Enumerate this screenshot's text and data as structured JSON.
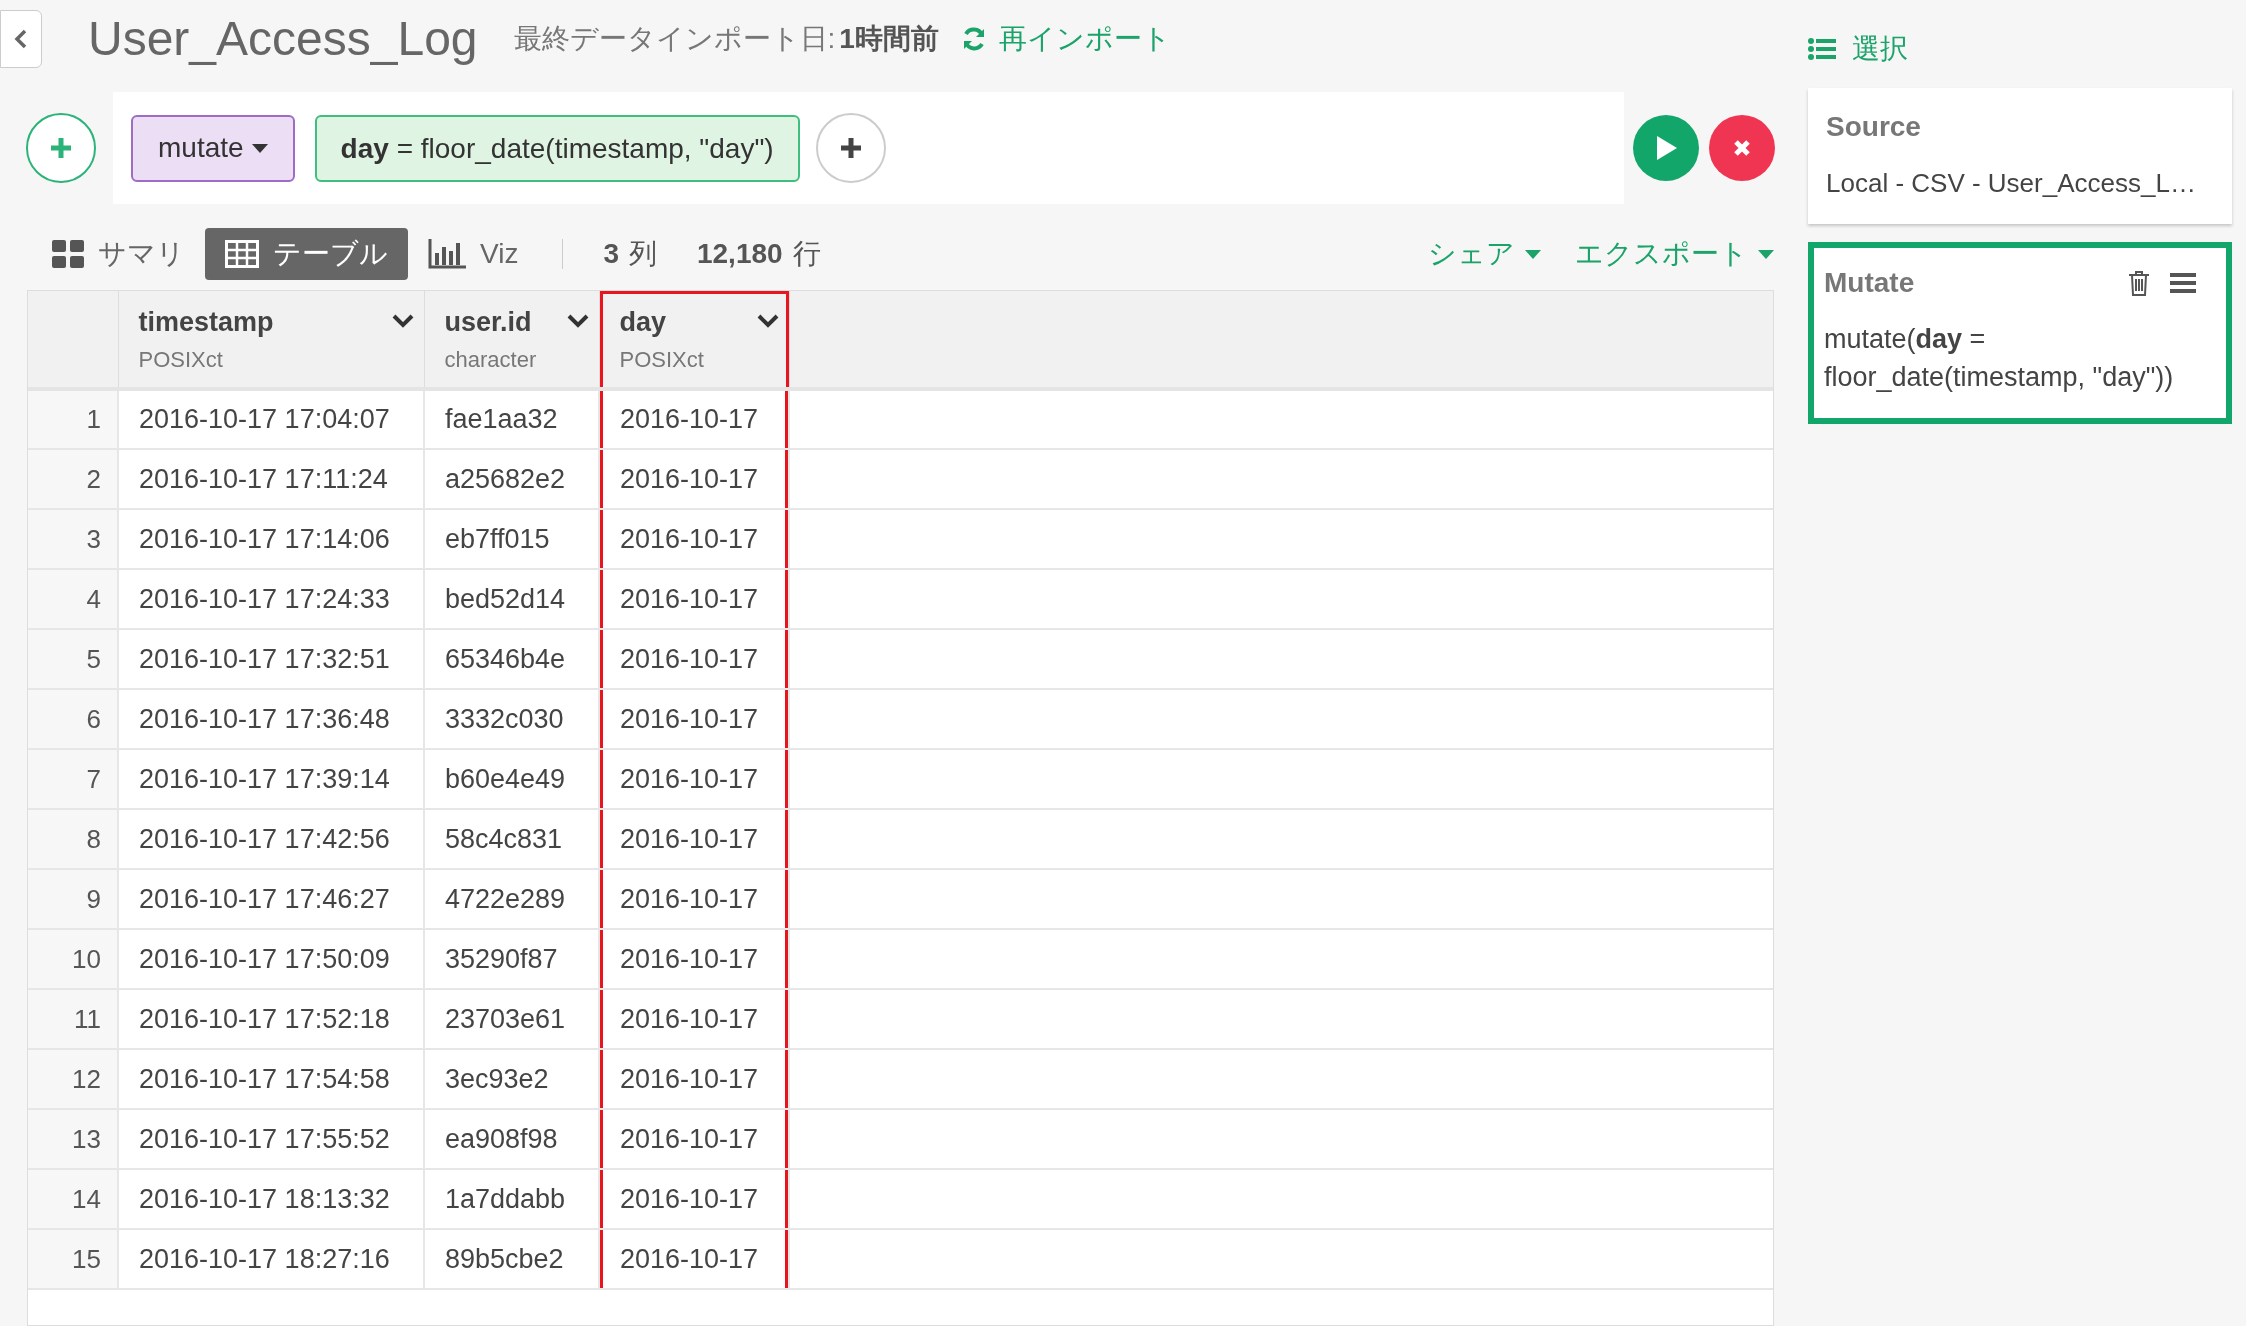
{
  "header": {
    "title": "User_Access_Log",
    "import_label": "最終データインポート日:",
    "import_time": "1時間前",
    "reimport": "再インポート",
    "select": "選択"
  },
  "pipeline": {
    "command": "mutate",
    "expression": "**day** = floor_date(timestamp, \"day\")"
  },
  "view_tabs": [
    {
      "kind": "summary",
      "label": "サマリ",
      "selected": false
    },
    {
      "kind": "table",
      "label": "テーブル",
      "selected": true
    },
    {
      "kind": "viz",
      "label": "Viz",
      "selected": false
    }
  ],
  "counts": {
    "columns": "3",
    "columns_unit": "列",
    "rows": "12,180",
    "rows_unit": "行"
  },
  "menus": [
    "シェア",
    "エクスポート"
  ],
  "table": {
    "columns": [
      {
        "name": "timestamp",
        "type": "POSIXct",
        "highlighted": false
      },
      {
        "name": "user.id",
        "type": "character",
        "highlighted": false
      },
      {
        "name": "day",
        "type": "POSIXct",
        "highlighted": true
      }
    ],
    "rows": [
      {
        "number": "1",
        "cells": [
          "2016-10-17 17:04:07",
          "fae1aa32",
          "2016-10-17"
        ]
      },
      {
        "number": "2",
        "cells": [
          "2016-10-17 17:11:24",
          "a25682e2",
          "2016-10-17"
        ]
      },
      {
        "number": "3",
        "cells": [
          "2016-10-17 17:14:06",
          "eb7ff015",
          "2016-10-17"
        ]
      },
      {
        "number": "4",
        "cells": [
          "2016-10-17 17:24:33",
          "bed52d14",
          "2016-10-17"
        ]
      },
      {
        "number": "5",
        "cells": [
          "2016-10-17 17:32:51",
          "65346b4e",
          "2016-10-17"
        ]
      },
      {
        "number": "6",
        "cells": [
          "2016-10-17 17:36:48",
          "3332c030",
          "2016-10-17"
        ]
      },
      {
        "number": "7",
        "cells": [
          "2016-10-17 17:39:14",
          "b60e4e49",
          "2016-10-17"
        ]
      },
      {
        "number": "8",
        "cells": [
          "2016-10-17 17:42:56",
          "58c4c831",
          "2016-10-17"
        ]
      },
      {
        "number": "9",
        "cells": [
          "2016-10-17 17:46:27",
          "4722e289",
          "2016-10-17"
        ]
      },
      {
        "number": "10",
        "cells": [
          "2016-10-17 17:50:09",
          "35290f87",
          "2016-10-17"
        ]
      },
      {
        "number": "11",
        "cells": [
          "2016-10-17 17:52:18",
          "23703e61",
          "2016-10-17"
        ]
      },
      {
        "number": "12",
        "cells": [
          "2016-10-17 17:54:58",
          "3ec93e2",
          "2016-10-17"
        ]
      },
      {
        "number": "13",
        "cells": [
          "2016-10-17 17:55:52",
          "ea908f98",
          "2016-10-17"
        ]
      },
      {
        "number": "14",
        "cells": [
          "2016-10-17 18:13:32",
          "1a7ddabb",
          "2016-10-17"
        ]
      },
      {
        "number": "15",
        "cells": [
          "2016-10-17 18:27:16",
          "89b5cbe2",
          "2016-10-17"
        ]
      }
    ]
  },
  "steps": [
    {
      "kind": "source",
      "title": "Source",
      "body": "Local - CSV - User_Access_L…",
      "selected": false
    },
    {
      "kind": "mutate",
      "title": "Mutate",
      "body": "mutate(**day** = floor_date(timestamp, \"day\"))",
      "selected": true
    }
  ]
}
